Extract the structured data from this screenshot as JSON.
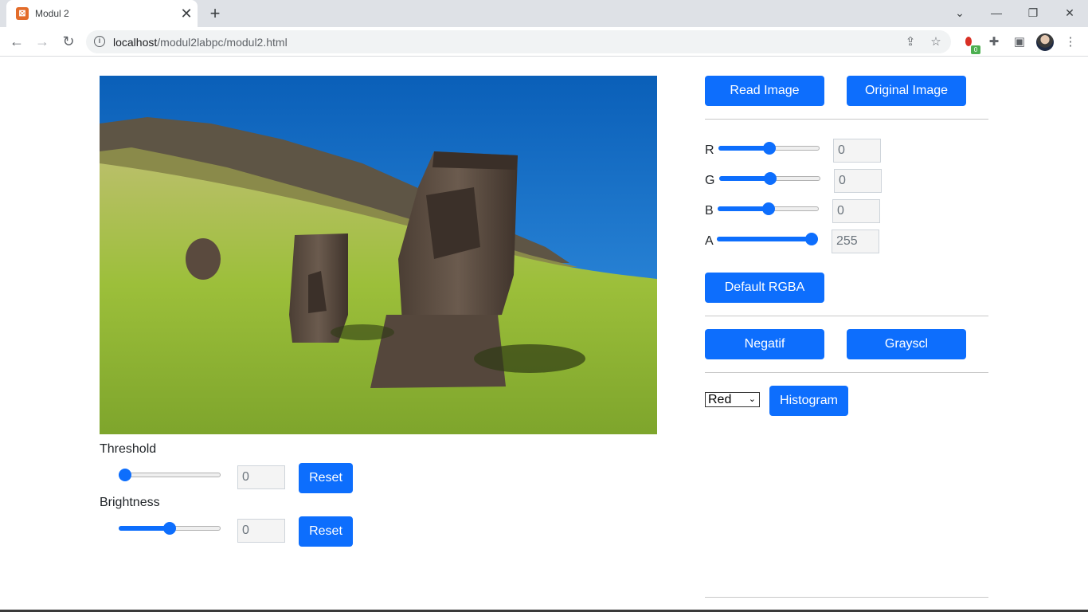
{
  "browser": {
    "tab_title": "Modul 2",
    "tab_favicon": "xampp-icon",
    "new_tab_label": "+",
    "close_tab_label": "✕",
    "url_host": "localhost",
    "url_path": "/modul2labpc/modul2.html",
    "extension_badge": "0"
  },
  "page": {
    "image_alt": "Easter Island moai statues on grassy hillside",
    "threshold": {
      "label": "Threshold",
      "value": "0",
      "level_fraction": 0.0,
      "reset_label": "Reset"
    },
    "brightness": {
      "label": "Brightness",
      "value": "0",
      "level_fraction": 0.5,
      "reset_label": "Reset"
    },
    "read_image_label": "Read Image",
    "original_image_label": "Original Image",
    "rgba": [
      {
        "label": "R",
        "value": "0",
        "level_fraction": 0.5
      },
      {
        "label": "G",
        "value": "0",
        "level_fraction": 0.5
      },
      {
        "label": "B",
        "value": "0",
        "level_fraction": 0.5
      },
      {
        "label": "A",
        "value": "255",
        "level_fraction": 1.0
      }
    ],
    "default_rgba_label": "Default RGBA",
    "negatif_label": "Negatif",
    "grayscl_label": "Grayscl",
    "histogram_channel": "Red",
    "histogram_label": "Histogram"
  },
  "colors": {
    "accent": "#0d6efd",
    "sky": "#1e7fd8",
    "grass": "#8fb43a"
  }
}
